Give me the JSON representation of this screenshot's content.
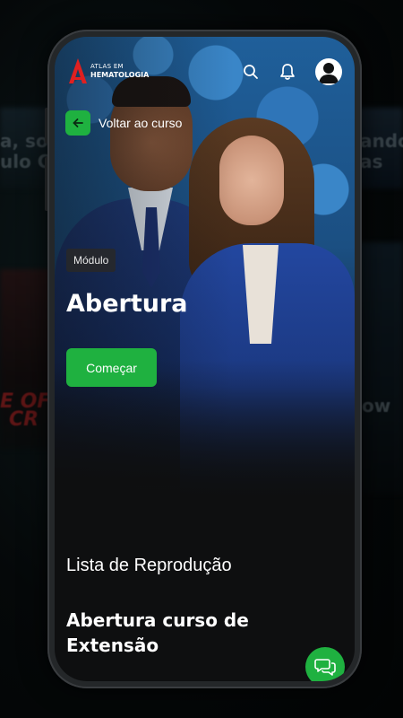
{
  "brand": {
    "logo_line1": "ATLAS EM",
    "logo_line2": "HEMATOLOGIA",
    "accent_color": "#1fb140",
    "logo_color": "#e02020"
  },
  "header": {
    "icons": [
      "search-icon",
      "bell-icon",
      "user-avatar-icon"
    ]
  },
  "nav": {
    "back_label": "Voltar ao curso"
  },
  "hero": {
    "badge": "Módulo",
    "title": "Abertura",
    "start_label": "Começar"
  },
  "playlist": {
    "heading": "Lista de Reprodução",
    "items": [
      {
        "title": "Abertura curso de Extensão"
      }
    ]
  },
  "background": {
    "blurred_texts": [
      "a, sou",
      "ulo Co",
      "ando",
      "as",
      "E OF",
      "CR",
      "ow"
    ]
  },
  "chat": {
    "icon": "chat-icon"
  }
}
